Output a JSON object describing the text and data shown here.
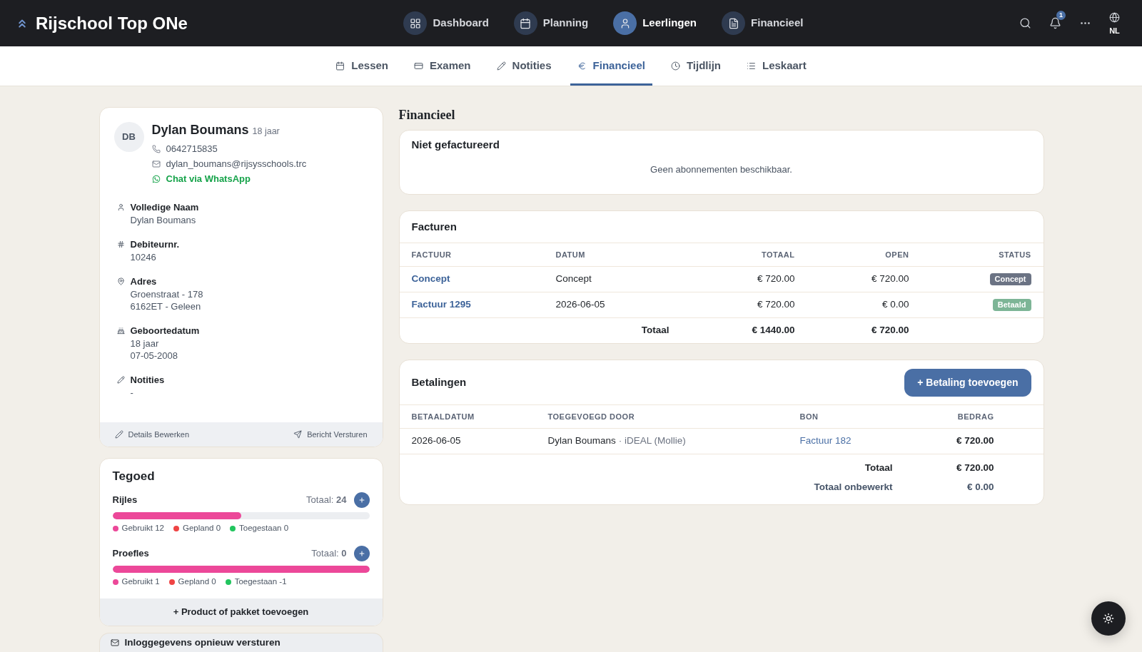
{
  "header": {
    "brand": "Rijschool Top ONe",
    "nav": [
      {
        "label": "Dashboard",
        "selected": false
      },
      {
        "label": "Planning",
        "selected": false
      },
      {
        "label": "Leerlingen",
        "selected": true
      },
      {
        "label": "Financieel",
        "selected": false
      }
    ],
    "notification_count": "1",
    "language": "NL"
  },
  "tabs": [
    {
      "label": "Lessen",
      "selected": false
    },
    {
      "label": "Examen",
      "selected": false
    },
    {
      "label": "Notities",
      "selected": false
    },
    {
      "label": "Financieel",
      "selected": true
    },
    {
      "label": "Tijdlijn",
      "selected": false
    },
    {
      "label": "Leskaart",
      "selected": false
    }
  ],
  "student": {
    "initials": "DB",
    "name": "Dylan Boumans",
    "age": "18 jaar",
    "phone": "0642715835",
    "email": "dylan_boumans@rijsysschools.trc",
    "whatsapp": "Chat via WhatsApp",
    "fields": [
      {
        "label": "Volledige Naam",
        "lines": [
          "Dylan Boumans"
        ]
      },
      {
        "label": "Debiteurnr.",
        "lines": [
          "10246"
        ]
      },
      {
        "label": "Adres",
        "lines": [
          "Groenstraat - 178",
          "6162ET - Geleen"
        ]
      },
      {
        "label": "Geboortedatum",
        "lines": [
          "18 jaar",
          "07-05-2008"
        ]
      },
      {
        "label": "Notities",
        "lines": [
          "-"
        ]
      }
    ],
    "actions": [
      "Details Bewerken",
      "Bericht Versturen"
    ]
  },
  "credit": {
    "title": "Tegoed",
    "items": [
      {
        "name": "Rijles",
        "total": "Totaal: **24**",
        "level": 0.5,
        "legend": [
          {
            "label": "Gebruikt 12",
            "color": "#ec4899"
          },
          {
            "label": "Gepland 0",
            "color": "#ef4444"
          },
          {
            "label": "Toegestaan 0",
            "color": "#22c55e"
          }
        ]
      },
      {
        "name": "Proefles",
        "total": "Totaal: **0**",
        "level": 1,
        "legend": [
          {
            "label": "Gebruikt 1",
            "color": "#ec4899"
          },
          {
            "label": "Gepland 0",
            "color": "#ef4444"
          },
          {
            "label": "Toegestaan -1",
            "color": "#22c55e"
          }
        ]
      }
    ],
    "add_button": "+ Product of pakket toevoegen"
  },
  "resend_login": {
    "label": "Inloggegevens opnieuw versturen"
  },
  "finance": {
    "title": "Financieel",
    "unbilled": {
      "title": "Niet gefactureerd",
      "empty": "Geen abonnementen beschikbaar."
    },
    "invoices": {
      "title": "Facturen",
      "columns": [
        "FACTUUR",
        "DATUM",
        "TOTAAL",
        "OPEN",
        "STATUS"
      ],
      "rows": [
        {
          "invoice": "Concept",
          "date": "Concept",
          "total": "€ 720.00",
          "open": "€ 720.00",
          "status": {
            "label": "Concept",
            "color": "#6b7384"
          }
        },
        {
          "invoice": "Factuur 1295",
          "date": "2026-06-05",
          "total": "€ 720.00",
          "open": "€ 0.00",
          "status": {
            "label": "Betaald",
            "color": "#7db596"
          }
        }
      ],
      "footer": {
        "label": "Totaal",
        "total": "€ 1440.00",
        "open": "€ 720.00"
      }
    },
    "payments": {
      "title": "Betalingen",
      "add_button": "+ Betaling toevoegen",
      "columns": [
        "BETAALDATUM",
        "TOEGEVOEGD DOOR",
        "BON",
        "BEDRAG"
      ],
      "rows": [
        {
          "date": "2026-06-05",
          "added_by": "Dylan Boumans",
          "method": "· iDEAL (Mollie)",
          "receipt": "Factuur 182",
          "amount": "€ 720.00"
        }
      ],
      "totals": [
        {
          "kind": "total",
          "label": "Totaal",
          "value": "€ 720.00"
        },
        {
          "kind": "unprocessed",
          "label": "Totaal onbewerkt",
          "value": "€ 0.00"
        }
      ]
    }
  }
}
